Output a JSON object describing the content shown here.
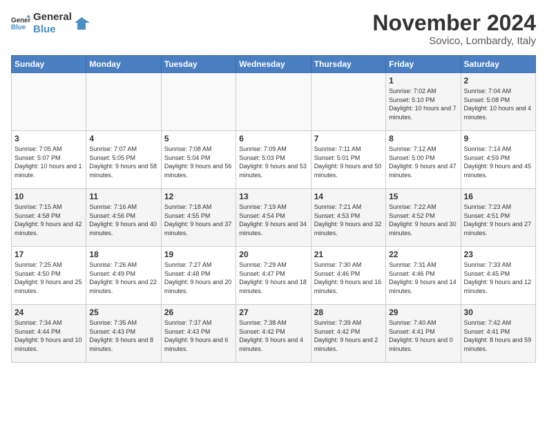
{
  "header": {
    "logo_general": "General",
    "logo_blue": "Blue",
    "month_title": "November 2024",
    "location": "Sovico, Lombardy, Italy"
  },
  "days_of_week": [
    "Sunday",
    "Monday",
    "Tuesday",
    "Wednesday",
    "Thursday",
    "Friday",
    "Saturday"
  ],
  "weeks": [
    [
      {
        "day": "",
        "info": ""
      },
      {
        "day": "",
        "info": ""
      },
      {
        "day": "",
        "info": ""
      },
      {
        "day": "",
        "info": ""
      },
      {
        "day": "",
        "info": ""
      },
      {
        "day": "1",
        "info": "Sunrise: 7:02 AM\nSunset: 5:10 PM\nDaylight: 10 hours and 7 minutes."
      },
      {
        "day": "2",
        "info": "Sunrise: 7:04 AM\nSunset: 5:08 PM\nDaylight: 10 hours and 4 minutes."
      }
    ],
    [
      {
        "day": "3",
        "info": "Sunrise: 7:05 AM\nSunset: 5:07 PM\nDaylight: 10 hours and 1 minute."
      },
      {
        "day": "4",
        "info": "Sunrise: 7:07 AM\nSunset: 5:05 PM\nDaylight: 9 hours and 58 minutes."
      },
      {
        "day": "5",
        "info": "Sunrise: 7:08 AM\nSunset: 5:04 PM\nDaylight: 9 hours and 56 minutes."
      },
      {
        "day": "6",
        "info": "Sunrise: 7:09 AM\nSunset: 5:03 PM\nDaylight: 9 hours and 53 minutes."
      },
      {
        "day": "7",
        "info": "Sunrise: 7:11 AM\nSunset: 5:01 PM\nDaylight: 9 hours and 50 minutes."
      },
      {
        "day": "8",
        "info": "Sunrise: 7:12 AM\nSunset: 5:00 PM\nDaylight: 9 hours and 47 minutes."
      },
      {
        "day": "9",
        "info": "Sunrise: 7:14 AM\nSunset: 4:59 PM\nDaylight: 9 hours and 45 minutes."
      }
    ],
    [
      {
        "day": "10",
        "info": "Sunrise: 7:15 AM\nSunset: 4:58 PM\nDaylight: 9 hours and 42 minutes."
      },
      {
        "day": "11",
        "info": "Sunrise: 7:16 AM\nSunset: 4:56 PM\nDaylight: 9 hours and 40 minutes."
      },
      {
        "day": "12",
        "info": "Sunrise: 7:18 AM\nSunset: 4:55 PM\nDaylight: 9 hours and 37 minutes."
      },
      {
        "day": "13",
        "info": "Sunrise: 7:19 AM\nSunset: 4:54 PM\nDaylight: 9 hours and 34 minutes."
      },
      {
        "day": "14",
        "info": "Sunrise: 7:21 AM\nSunset: 4:53 PM\nDaylight: 9 hours and 32 minutes."
      },
      {
        "day": "15",
        "info": "Sunrise: 7:22 AM\nSunset: 4:52 PM\nDaylight: 9 hours and 30 minutes."
      },
      {
        "day": "16",
        "info": "Sunrise: 7:23 AM\nSunset: 4:51 PM\nDaylight: 9 hours and 27 minutes."
      }
    ],
    [
      {
        "day": "17",
        "info": "Sunrise: 7:25 AM\nSunset: 4:50 PM\nDaylight: 9 hours and 25 minutes."
      },
      {
        "day": "18",
        "info": "Sunrise: 7:26 AM\nSunset: 4:49 PM\nDaylight: 9 hours and 22 minutes."
      },
      {
        "day": "19",
        "info": "Sunrise: 7:27 AM\nSunset: 4:48 PM\nDaylight: 9 hours and 20 minutes."
      },
      {
        "day": "20",
        "info": "Sunrise: 7:29 AM\nSunset: 4:47 PM\nDaylight: 9 hours and 18 minutes."
      },
      {
        "day": "21",
        "info": "Sunrise: 7:30 AM\nSunset: 4:46 PM\nDaylight: 9 hours and 16 minutes."
      },
      {
        "day": "22",
        "info": "Sunrise: 7:31 AM\nSunset: 4:46 PM\nDaylight: 9 hours and 14 minutes."
      },
      {
        "day": "23",
        "info": "Sunrise: 7:33 AM\nSunset: 4:45 PM\nDaylight: 9 hours and 12 minutes."
      }
    ],
    [
      {
        "day": "24",
        "info": "Sunrise: 7:34 AM\nSunset: 4:44 PM\nDaylight: 9 hours and 10 minutes."
      },
      {
        "day": "25",
        "info": "Sunrise: 7:35 AM\nSunset: 4:43 PM\nDaylight: 9 hours and 8 minutes."
      },
      {
        "day": "26",
        "info": "Sunrise: 7:37 AM\nSunset: 4:43 PM\nDaylight: 9 hours and 6 minutes."
      },
      {
        "day": "27",
        "info": "Sunrise: 7:38 AM\nSunset: 4:42 PM\nDaylight: 9 hours and 4 minutes."
      },
      {
        "day": "28",
        "info": "Sunrise: 7:39 AM\nSunset: 4:42 PM\nDaylight: 9 hours and 2 minutes."
      },
      {
        "day": "29",
        "info": "Sunrise: 7:40 AM\nSunset: 4:41 PM\nDaylight: 9 hours and 0 minutes."
      },
      {
        "day": "30",
        "info": "Sunrise: 7:42 AM\nSunset: 4:41 PM\nDaylight: 8 hours and 59 minutes."
      }
    ]
  ]
}
